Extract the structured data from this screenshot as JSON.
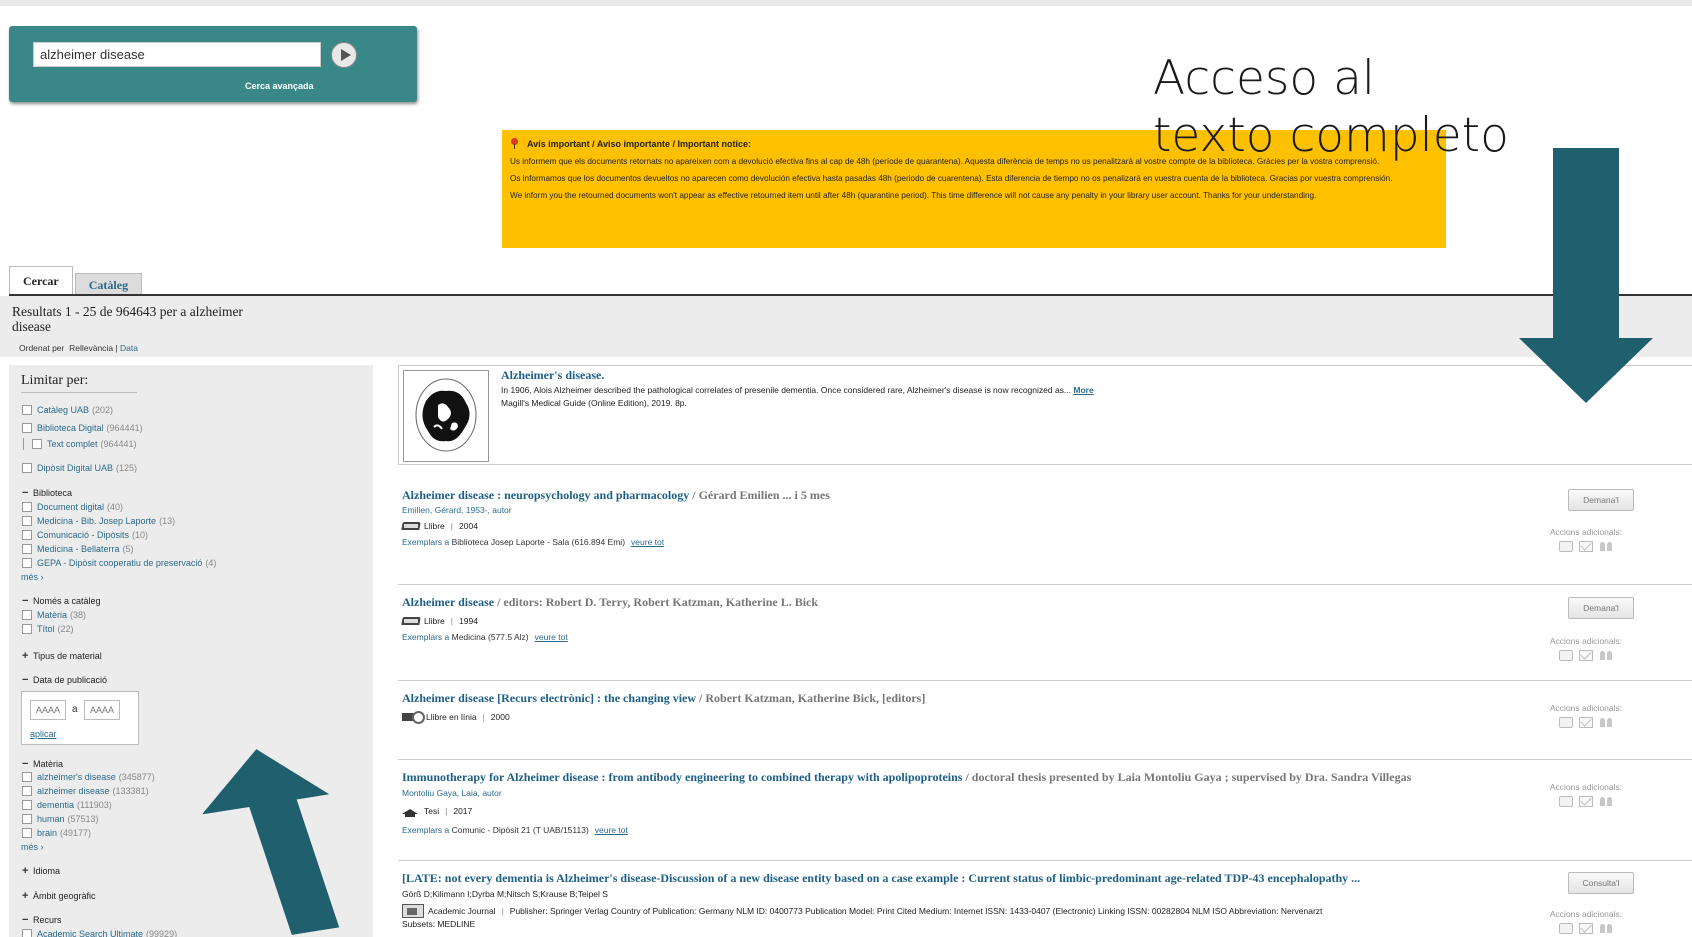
{
  "search": {
    "value": "alzheimer disease",
    "advanced_label": "Cerca avançada"
  },
  "annotation": {
    "line1": "Acceso al",
    "line2": "texto completo"
  },
  "notice": {
    "title": "Avís important / Aviso importante / Important notice:",
    "ca": "Us informem que els documents retornats no apareixen com a devolució efectiva fins al cap de 48h (període de quarantena). Aquesta diferència de temps no us penalitzarà al vostre compte de la biblioteca. Gràcies per la vostra comprensió.",
    "es": "Os informamos que los documentos devueltos no aparecen como devolución efectiva hasta pasadas 48h (periodo de cuarentena). Esta diferencia de tiempo no os penalizará en vuestra cuenta de la biblioteca. Gracias por vuestra comprensión.",
    "en": "We inform you the retourned documents won't appear as effective retourned item until after 48h (quarantine period). This time difference will not cause any penalty in your library user account. Thanks for your understanding."
  },
  "tabs": [
    "Cercar",
    "Catàleg"
  ],
  "results_header": {
    "count_text": "Resultats 1 - 25 de 964643 per a alzheimer disease",
    "sort_label": "Ordenat per",
    "sort_active": "Rellevància",
    "sort_sep": "|",
    "sort_other": "Data"
  },
  "sidebar": {
    "title": "Limitar per:",
    "top_items": [
      {
        "label": "Catàleg UAB",
        "count": "(202)"
      },
      {
        "label": "Biblioteca Digital",
        "count": "(964441)"
      },
      {
        "label": "Text complet",
        "count": "(964441)"
      },
      {
        "label": "Dipòsit Digital UAB",
        "count": "(125)"
      }
    ],
    "biblioteca": {
      "head": "Biblioteca",
      "items": [
        {
          "label": "Document digital",
          "count": "(40)"
        },
        {
          "label": "Medicina - Bib. Josep Laporte",
          "count": "(13)"
        },
        {
          "label": "Comunicació - Dipòsits",
          "count": "(10)"
        },
        {
          "label": "Medicina - Bellaterra",
          "count": "(5)"
        },
        {
          "label": "GEPA - Dipòsit cooperatiu de preservació",
          "count": "(4)"
        }
      ],
      "more": "més"
    },
    "nomes": {
      "head": "Només a catàleg",
      "items": [
        {
          "label": "Matèria",
          "count": "(38)"
        },
        {
          "label": "Títol",
          "count": "(22)"
        }
      ]
    },
    "tipus_head": "Tipus de material",
    "data_head": "Data de publicació",
    "date_from": "AAAA",
    "date_to": "AAAA",
    "date_sep": "a",
    "date_apply": "aplicar",
    "materia": {
      "head": "Matèria",
      "items": [
        {
          "label": "alzheimer's disease",
          "count": "(345877)"
        },
        {
          "label": "alzheimer disease",
          "count": "(133381)"
        },
        {
          "label": "dementia",
          "count": "(111903)"
        },
        {
          "label": "human",
          "count": "(57513)"
        },
        {
          "label": "brain",
          "count": "(49177)"
        }
      ],
      "more": "més"
    },
    "idioma_head": "Idioma",
    "ambit_head": "Àmbit geogràfic",
    "recurs": {
      "head": "Recurs",
      "items": [
        {
          "label": "Academic Search Ultimate",
          "count": "(99929)"
        }
      ]
    }
  },
  "featured": {
    "title": "Alzheimer's disease.",
    "desc": "In 1906, Alois Alzheimer described the pathological correlates of presenile dementia. Once considered rare, Alzheimer's disease is now recognized as...",
    "more": "More",
    "source": "Magill's Medical Guide (Online Edition), 2019. 8p."
  },
  "results": [
    {
      "title": "Alzheimer disease : neuropsychology and pharmacology",
      "resp": " / Gérard Emilien ... i 5 mes",
      "author": "Emilien, Gérard, 1953-, autor",
      "format": "Llibre",
      "year": "2004",
      "hold_label": "Exemplars a",
      "hold_loc": "Biblioteca Josep Laporte - Sala (616.894 Emi)",
      "hold_link": "veure tot",
      "button": "Demana'l",
      "actions_label": "Accions adicionals:"
    },
    {
      "title": "Alzheimer disease",
      "resp": " / editors: Robert D. Terry, Robert Katzman, Katherine L. Bick",
      "format": "Llibre",
      "year": "1994",
      "hold_label": "Exemplars a",
      "hold_loc": "Medicina (577.5 Alz)",
      "hold_link": "veure tot",
      "button": "Demana'l",
      "actions_label": "Accions adicionals:"
    },
    {
      "title": "Alzheimer disease [Recurs electrònic] : the changing view",
      "resp": " / Robert Katzman, Katherine Bick, [editors]",
      "format": "Llibre en línia",
      "year": "2000",
      "actions_label": "Accions adicionals:"
    },
    {
      "title": "Immunotherapy for Alzheimer disease : from antibody engineering to combined therapy with apolipoproteins",
      "resp": " / doctoral thesis presented by Laia Montoliu Gaya ; supervised by Dra. Sandra Villegas",
      "author": "Montoliu Gaya, Laia, autor",
      "format": "Tesi",
      "year": "2017",
      "hold_label": "Exemplars a",
      "hold_loc": "Comunic - Dipòsit 21 (T UAB/15113)",
      "hold_link": "veure tot",
      "actions_label": "Accions adicionals:"
    },
    {
      "title": "[LATE: not every dementia is Alzheimer's disease-Discussion of a new disease entity based on a case example : Current status of limbic-predominant age-related TDP-43 encephalopathy ...",
      "author": "Görß D;Kilimann I;Dyrba M;Nitsch S;Krause B;Teipel S",
      "format": "Academic Journal",
      "publisher": "Publisher: Springer Verlag Country of Publication: Germany NLM ID: 0400773 Publication Model: Print Cited Medium: Internet ISSN: 1433-0407 (Electronic) Linking ISSN: 00282804 NLM ISO Abbreviation: Nervenarzt",
      "subsets": "Subsets: MEDLINE",
      "button": "Consulta'l",
      "actions_label": "Accions adicionals:"
    }
  ],
  "colors": {
    "teal_box": "#3a8787",
    "notice_bg": "#ffc000",
    "arrow": "#1f5f6e",
    "link": "#1e5f86"
  }
}
